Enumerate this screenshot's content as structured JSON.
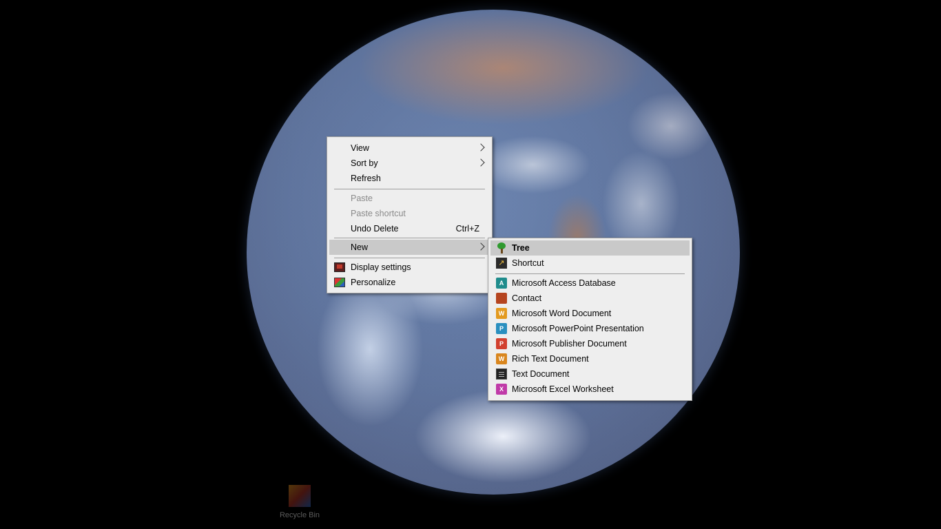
{
  "wallpaper": {
    "name": "earth-wallpaper"
  },
  "desktop_icon": {
    "label": "Recycle Bin"
  },
  "context_menu": {
    "items": [
      {
        "label": "View",
        "submenu": true
      },
      {
        "label": "Sort by",
        "submenu": true
      },
      {
        "label": "Refresh"
      },
      {
        "label": "Paste",
        "disabled": true
      },
      {
        "label": "Paste shortcut",
        "disabled": true
      },
      {
        "label": "Undo Delete",
        "shortcut": "Ctrl+Z"
      },
      {
        "label": "New",
        "submenu": true,
        "highlighted": true
      },
      {
        "label": "Display settings",
        "icon": "display-settings-icon"
      },
      {
        "label": "Personalize",
        "icon": "personalize-icon"
      }
    ]
  },
  "new_submenu": {
    "items": [
      {
        "label": "Tree",
        "icon": "tree-icon",
        "highlighted": true
      },
      {
        "label": "Shortcut",
        "icon": "shortcut-icon"
      },
      {
        "label": "Microsoft Access Database",
        "icon": "access-icon",
        "glyph": "A"
      },
      {
        "label": "Contact",
        "icon": "contact-icon",
        "glyph": ""
      },
      {
        "label": "Microsoft Word Document",
        "icon": "word-icon",
        "glyph": "W"
      },
      {
        "label": "Microsoft PowerPoint Presentation",
        "icon": "powerpoint-icon",
        "glyph": "P"
      },
      {
        "label": "Microsoft Publisher Document",
        "icon": "publisher-icon",
        "glyph": "P"
      },
      {
        "label": "Rich Text Document",
        "icon": "rich-text-icon",
        "glyph": "W"
      },
      {
        "label": "Text Document",
        "icon": "text-document-icon"
      },
      {
        "label": "Microsoft Excel Worksheet",
        "icon": "excel-icon",
        "glyph": "X"
      }
    ]
  },
  "colors": {
    "menu_bg": "#eeeeee",
    "hover": "#c9c9c9",
    "disabled_text": "#8a8a8a"
  }
}
